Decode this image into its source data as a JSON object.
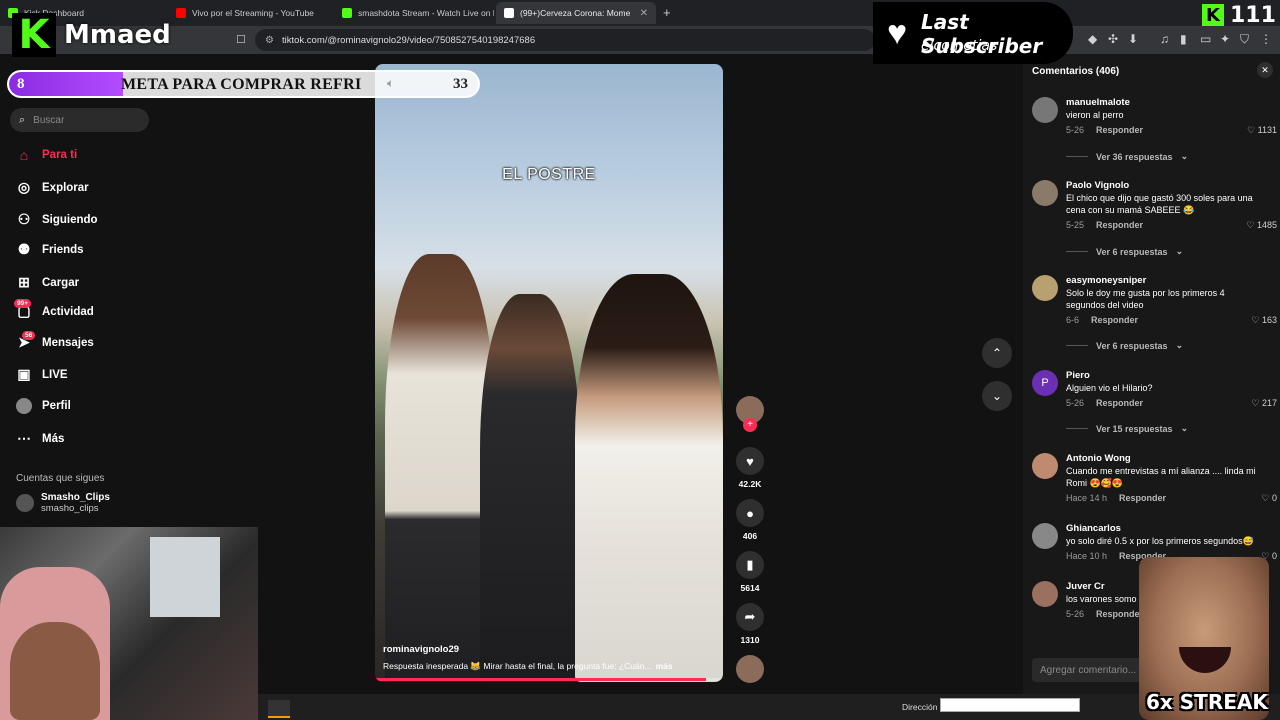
{
  "browser": {
    "tabs": [
      {
        "label": "Kick Dashboard",
        "icon": "kick-icon",
        "color": "#53fc18"
      },
      {
        "label": "Vivo por el Streaming - YouTube",
        "icon": "youtube-icon",
        "color": "#ff0000"
      },
      {
        "label": "smashdota Stream - Watch Live on K",
        "icon": "kick-icon",
        "color": "#53fc18"
      },
      {
        "label": "(99+)Cerveza Corona: Mome",
        "icon": "tiktok-icon",
        "color": "#ffffff",
        "active": true
      }
    ],
    "url": "tiktok.com/@rominavignolo29/video/7508527540198247686"
  },
  "sidebar": {
    "search_placeholder": "Buscar",
    "items": [
      {
        "label": "Para ti",
        "icon": "home-icon",
        "active": true
      },
      {
        "label": "Explorar",
        "icon": "compass-icon"
      },
      {
        "label": "Siguiendo",
        "icon": "user-follow-icon"
      },
      {
        "label": "Friends",
        "icon": "friends-icon"
      },
      {
        "label": "Cargar",
        "icon": "upload-icon"
      },
      {
        "label": "Actividad",
        "icon": "activity-icon",
        "badge": "99+"
      },
      {
        "label": "Mensajes",
        "icon": "messages-icon",
        "badge": "56"
      },
      {
        "label": "LIVE",
        "icon": "live-icon"
      },
      {
        "label": "Perfil",
        "icon": "profile-icon"
      },
      {
        "label": "Más",
        "icon": "more-icon"
      }
    ],
    "following_title": "Cuentas que sigues",
    "following": [
      {
        "name": "Smasho_Clips",
        "handle": "smasho_clips"
      }
    ]
  },
  "video": {
    "overlay_text": "EL POSTRE",
    "username": "rominavignolo29",
    "description": "Respuesta inesperada 😹  Mirar hasta el final, la pregunta fue: ¿Cuán...",
    "more": "más",
    "progress": 0.95,
    "likes": "42.2K",
    "comments": "406",
    "saves": "5614",
    "shares": "1310"
  },
  "comments": {
    "title": "Comentarios (406)",
    "input_placeholder": "Agregar comentario...",
    "reply_label": "Responder",
    "items": [
      {
        "user": "manuelmalote",
        "text": "vieron al perro",
        "date": "5-26",
        "likes": "1131",
        "more": "Ver 36 respuestas"
      },
      {
        "user": "Paolo Vignolo",
        "text": "El chico que dijo que gastó 300 soles para una cena con su mamá SABEEE 😂",
        "date": "5-25",
        "likes": "1485",
        "more": "Ver 6 respuestas"
      },
      {
        "user": "easymoneysniper",
        "text": "Solo le doy me gusta por los primeros 4 segundos del video",
        "date": "6-6",
        "likes": "163",
        "more": "Ver 6 respuestas"
      },
      {
        "user": "Piero",
        "avatar_letter": "P",
        "text": "Alguien vio el Hilario?",
        "date": "5-26",
        "likes": "217",
        "more": "Ver 15 respuestas"
      },
      {
        "user": "Antonio Wong",
        "text": "Cuando me entrevistas a mí alianza .... linda mi Romi 😍🥰😍",
        "date": "Hace 14 h",
        "likes": "0"
      },
      {
        "user": "Ghiancarlos",
        "text": "yo solo diré 0.5 x por los primeros segundos😅",
        "date": "Hace 10 h",
        "likes": "0"
      },
      {
        "user": "Juver Cr",
        "text": "los varones somo",
        "date": "5-26",
        "likes": ""
      }
    ]
  },
  "overlay": {
    "streamer": "Mmaed",
    "goal_current": "8",
    "goal_label": "META PARA COMPRAR REFRI",
    "goal_target": "33",
    "last_sub_title": "Last Subscriber",
    "last_sub_name": "elcometias",
    "viewers": "111",
    "streak": "6x STREAK"
  },
  "taskbar": {
    "address_label": "Dirección"
  }
}
